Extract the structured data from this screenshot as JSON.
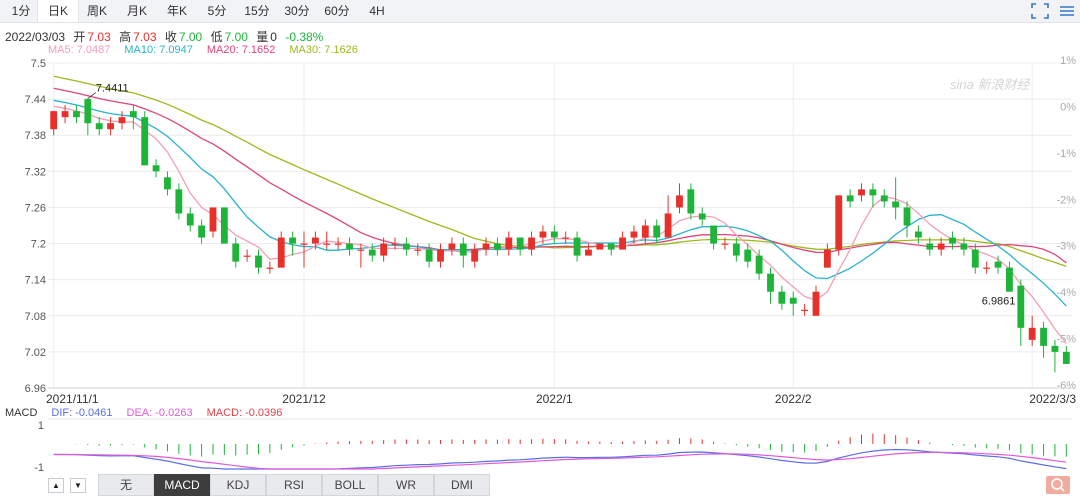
{
  "periods": [
    "1分",
    "日K",
    "周K",
    "月K",
    "年K",
    "5分",
    "15分",
    "30分",
    "60分",
    "4H"
  ],
  "active_period": "日K",
  "info": {
    "date": "2022/03/03",
    "open_label": "开",
    "open": "7.03",
    "high_label": "高",
    "high": "7.03",
    "close_label": "收",
    "close": "7.00",
    "low_label": "低",
    "low": "7.00",
    "vol_label": "量",
    "vol": "0",
    "change": "-0.38%"
  },
  "ma_legend": [
    {
      "text": "MA5: 7.0487",
      "color": "#f0a0b4"
    },
    {
      "text": "MA10: 7.0947",
      "color": "#29b3cc"
    },
    {
      "text": "MA20: 7.1652",
      "color": "#e0457b"
    },
    {
      "text": "MA30: 7.1626",
      "color": "#9dba1c"
    }
  ],
  "macd_legend": [
    {
      "text": "MACD",
      "color": "#333333"
    },
    {
      "text": "DIF: -0.0461",
      "color": "#5a6ee6"
    },
    {
      "text": "DEA: -0.0263",
      "color": "#e05ad8"
    },
    {
      "text": "MACD: -0.0396",
      "color": "#e0424c"
    }
  ],
  "watermark": "sina 新浪财经",
  "indicator_tabs": [
    "无",
    "MACD",
    "KDJ",
    "RSI",
    "BOLL",
    "WR",
    "DMI"
  ],
  "active_indicator": "MACD",
  "nav": {
    "up": "▲",
    "down": "▼"
  },
  "colors": {
    "up": "#e8302a",
    "down": "#1eb43a",
    "grid": "#ececec",
    "axis_text": "#555555",
    "pct_text": "#aaaaaa"
  },
  "chart_data": {
    "type": "candlestick",
    "price_axis": {
      "ylim": [
        6.96,
        7.5
      ],
      "ticks": [
        "7.5",
        "7.44",
        "7.38",
        "7.32",
        "7.26",
        "7.2",
        "7.14",
        "7.08",
        "7.02",
        "6.96"
      ]
    },
    "pct_axis": {
      "ticks": [
        "1%",
        "0%",
        "-1%",
        "-2%",
        "-3%",
        "-4%",
        "-5%",
        "-6%"
      ]
    },
    "x_labels": [
      {
        "label": "2021/11/1",
        "index": 0
      },
      {
        "label": "2021/12",
        "index": 22
      },
      {
        "label": "2022/1",
        "index": 44
      },
      {
        "label": "2022/2",
        "index": 65
      },
      {
        "label": "2022/3/3",
        "index": 86
      }
    ],
    "high_annotation": {
      "label": "7.4411",
      "index": 3
    },
    "low_annotation": {
      "label": "6.9861",
      "index": 84
    },
    "candles": [
      [
        7.39,
        7.42,
        7.42,
        7.38
      ],
      [
        7.41,
        7.42,
        7.43,
        7.4
      ],
      [
        7.42,
        7.41,
        7.43,
        7.4
      ],
      [
        7.44,
        7.4,
        7.441,
        7.38
      ],
      [
        7.4,
        7.39,
        7.41,
        7.38
      ],
      [
        7.39,
        7.4,
        7.41,
        7.38
      ],
      [
        7.4,
        7.41,
        7.42,
        7.39
      ],
      [
        7.42,
        7.41,
        7.43,
        7.39
      ],
      [
        7.41,
        7.33,
        7.42,
        7.33
      ],
      [
        7.33,
        7.32,
        7.34,
        7.31
      ],
      [
        7.31,
        7.29,
        7.32,
        7.28
      ],
      [
        7.29,
        7.25,
        7.3,
        7.24
      ],
      [
        7.25,
        7.23,
        7.26,
        7.22
      ],
      [
        7.23,
        7.21,
        7.24,
        7.2
      ],
      [
        7.22,
        7.26,
        7.26,
        7.21
      ],
      [
        7.26,
        7.2,
        7.26,
        7.2
      ],
      [
        7.2,
        7.17,
        7.21,
        7.16
      ],
      [
        7.18,
        7.18,
        7.19,
        7.17
      ],
      [
        7.18,
        7.16,
        7.19,
        7.15
      ],
      [
        7.16,
        7.16,
        7.17,
        7.15
      ],
      [
        7.16,
        7.21,
        7.22,
        7.16
      ],
      [
        7.21,
        7.2,
        7.22,
        7.18
      ],
      [
        7.2,
        7.2,
        7.22,
        7.16
      ],
      [
        7.2,
        7.21,
        7.22,
        7.19
      ],
      [
        7.2,
        7.2,
        7.22,
        7.19
      ],
      [
        7.2,
        7.2,
        7.21,
        7.19
      ],
      [
        7.2,
        7.19,
        7.21,
        7.18
      ],
      [
        7.19,
        7.19,
        7.2,
        7.16
      ],
      [
        7.19,
        7.18,
        7.2,
        7.17
      ],
      [
        7.18,
        7.2,
        7.21,
        7.17
      ],
      [
        7.2,
        7.2,
        7.21,
        7.19
      ],
      [
        7.2,
        7.19,
        7.21,
        7.18
      ],
      [
        7.19,
        7.19,
        7.2,
        7.18
      ],
      [
        7.19,
        7.17,
        7.2,
        7.16
      ],
      [
        7.17,
        7.19,
        7.2,
        7.16
      ],
      [
        7.19,
        7.2,
        7.21,
        7.18
      ],
      [
        7.2,
        7.18,
        7.21,
        7.16
      ],
      [
        7.17,
        7.19,
        7.2,
        7.16
      ],
      [
        7.19,
        7.2,
        7.21,
        7.18
      ],
      [
        7.2,
        7.19,
        7.21,
        7.18
      ],
      [
        7.19,
        7.21,
        7.22,
        7.18
      ],
      [
        7.21,
        7.19,
        7.21,
        7.18
      ],
      [
        7.19,
        7.21,
        7.22,
        7.18
      ],
      [
        7.21,
        7.22,
        7.23,
        7.2
      ],
      [
        7.22,
        7.21,
        7.23,
        7.2
      ],
      [
        7.21,
        7.21,
        7.22,
        7.2
      ],
      [
        7.21,
        7.18,
        7.22,
        7.17
      ],
      [
        7.18,
        7.19,
        7.2,
        7.18
      ],
      [
        7.19,
        7.2,
        7.2,
        7.19
      ],
      [
        7.2,
        7.19,
        7.2,
        7.18
      ],
      [
        7.19,
        7.21,
        7.22,
        7.19
      ],
      [
        7.21,
        7.22,
        7.23,
        7.2
      ],
      [
        7.21,
        7.23,
        7.24,
        7.2
      ],
      [
        7.23,
        7.21,
        7.24,
        7.2
      ],
      [
        7.21,
        7.25,
        7.28,
        7.21
      ],
      [
        7.26,
        7.28,
        7.3,
        7.25
      ],
      [
        7.29,
        7.25,
        7.3,
        7.24
      ],
      [
        7.25,
        7.24,
        7.26,
        7.23
      ],
      [
        7.23,
        7.2,
        7.23,
        7.19
      ],
      [
        7.2,
        7.2,
        7.21,
        7.19
      ],
      [
        7.2,
        7.18,
        7.21,
        7.17
      ],
      [
        7.19,
        7.17,
        7.2,
        7.16
      ],
      [
        7.18,
        7.15,
        7.19,
        7.14
      ],
      [
        7.15,
        7.12,
        7.16,
        7.1
      ],
      [
        7.12,
        7.1,
        7.13,
        7.09
      ],
      [
        7.11,
        7.1,
        7.12,
        7.08
      ],
      [
        7.09,
        7.09,
        7.1,
        7.08
      ],
      [
        7.08,
        7.12,
        7.13,
        7.08
      ],
      [
        7.16,
        7.19,
        7.2,
        7.16
      ],
      [
        7.19,
        7.28,
        7.28,
        7.18
      ],
      [
        7.28,
        7.27,
        7.29,
        7.26
      ],
      [
        7.28,
        7.29,
        7.3,
        7.27
      ],
      [
        7.29,
        7.28,
        7.3,
        7.26
      ],
      [
        7.28,
        7.27,
        7.29,
        7.26
      ],
      [
        7.27,
        7.26,
        7.31,
        7.24
      ],
      [
        7.26,
        7.23,
        7.27,
        7.21
      ],
      [
        7.22,
        7.21,
        7.23,
        7.2
      ],
      [
        7.2,
        7.19,
        7.21,
        7.18
      ],
      [
        7.19,
        7.2,
        7.21,
        7.18
      ],
      [
        7.21,
        7.2,
        7.22,
        7.19
      ],
      [
        7.2,
        7.19,
        7.21,
        7.18
      ],
      [
        7.19,
        7.16,
        7.2,
        7.15
      ],
      [
        7.16,
        7.16,
        7.17,
        7.15
      ],
      [
        7.17,
        7.16,
        7.18,
        7.15
      ],
      [
        7.16,
        7.12,
        7.17,
        7.12
      ],
      [
        7.13,
        7.06,
        7.14,
        7.03
      ],
      [
        7.04,
        7.06,
        7.08,
        7.03
      ],
      [
        7.06,
        7.03,
        7.07,
        7.01
      ],
      [
        7.03,
        7.02,
        7.04,
        6.986
      ],
      [
        7.02,
        7.0,
        7.03,
        7.0
      ]
    ],
    "macd": {
      "ylim": [
        -1.5,
        1.5
      ],
      "ticks": [
        "1",
        "-1"
      ]
    }
  }
}
